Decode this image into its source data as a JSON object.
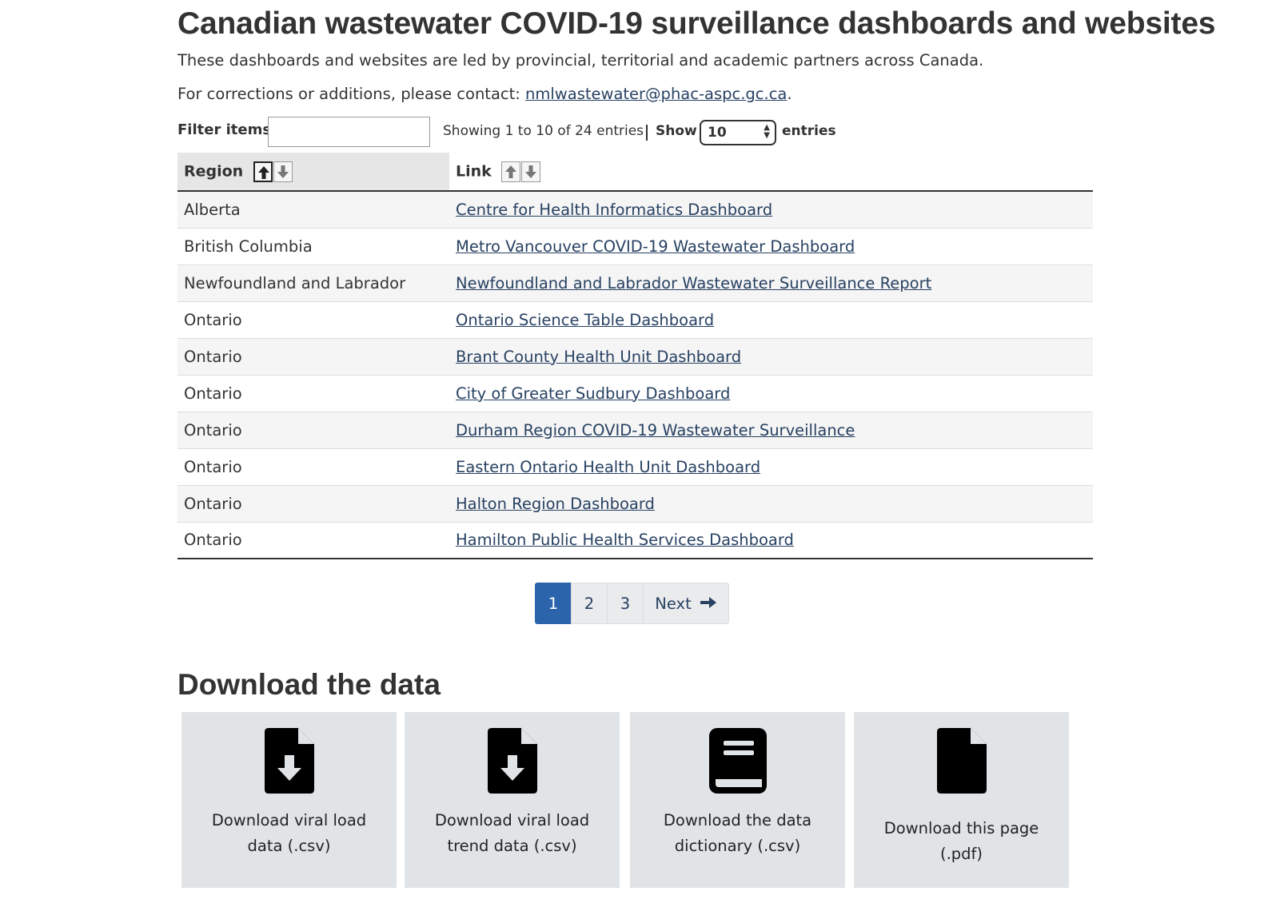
{
  "header": {
    "title": "Canadian wastewater COVID-19 surveillance dashboards and websites",
    "intro": "These dashboards and websites are led by provincial, territorial and academic partners across Canada.",
    "contact_prefix": "For corrections or additions, please contact: ",
    "contact_email": "nmlwastewater@phac-aspc.gc.ca",
    "contact_suffix": "."
  },
  "controls": {
    "filter_label": "Filter items",
    "filter_value": "",
    "info": "Showing 1 to 10 of 24 entries",
    "show_label": "Show",
    "show_value": "10",
    "entries_label": "entries"
  },
  "table": {
    "columns": [
      "Region",
      "Link"
    ],
    "sort": {
      "column": "Region",
      "direction": "ascending"
    },
    "rows": [
      {
        "region": "Alberta",
        "link": "Centre for Health Informatics Dashboard"
      },
      {
        "region": "British Columbia",
        "link": "Metro Vancouver COVID-19 Wastewater Dashboard"
      },
      {
        "region": "Newfoundland and Labrador",
        "link": "Newfoundland and Labrador Wastewater Surveillance Report"
      },
      {
        "region": "Ontario",
        "link": "Ontario Science Table Dashboard"
      },
      {
        "region": "Ontario",
        "link": "Brant County Health Unit Dashboard"
      },
      {
        "region": "Ontario",
        "link": "City of Greater Sudbury Dashboard"
      },
      {
        "region": "Ontario",
        "link": "Durham Region COVID-19 Wastewater Surveillance"
      },
      {
        "region": "Ontario",
        "link": "Eastern Ontario Health Unit Dashboard"
      },
      {
        "region": "Ontario",
        "link": "Halton Region Dashboard"
      },
      {
        "region": "Ontario",
        "link": "Hamilton Public Health Services Dashboard"
      }
    ]
  },
  "pagination": {
    "pages": [
      "1",
      "2",
      "3"
    ],
    "current": "1",
    "next_label": "Next"
  },
  "downloads": {
    "title": "Download the data",
    "cards": [
      {
        "label": "Download viral load data (.csv)",
        "icon": "file-download-icon"
      },
      {
        "label": "Download viral load trend data (.csv)",
        "icon": "file-download-icon"
      },
      {
        "label": "Download the data dictionary (.csv)",
        "icon": "book-icon"
      },
      {
        "label": "Download this page (.pdf)",
        "icon": "file-pdf-icon"
      }
    ]
  },
  "colors": {
    "link": "#284162",
    "pagination_active": "#2b64ab",
    "card_bg": "#e1e4e7",
    "header_sorted_bg": "#e6e6e6"
  }
}
